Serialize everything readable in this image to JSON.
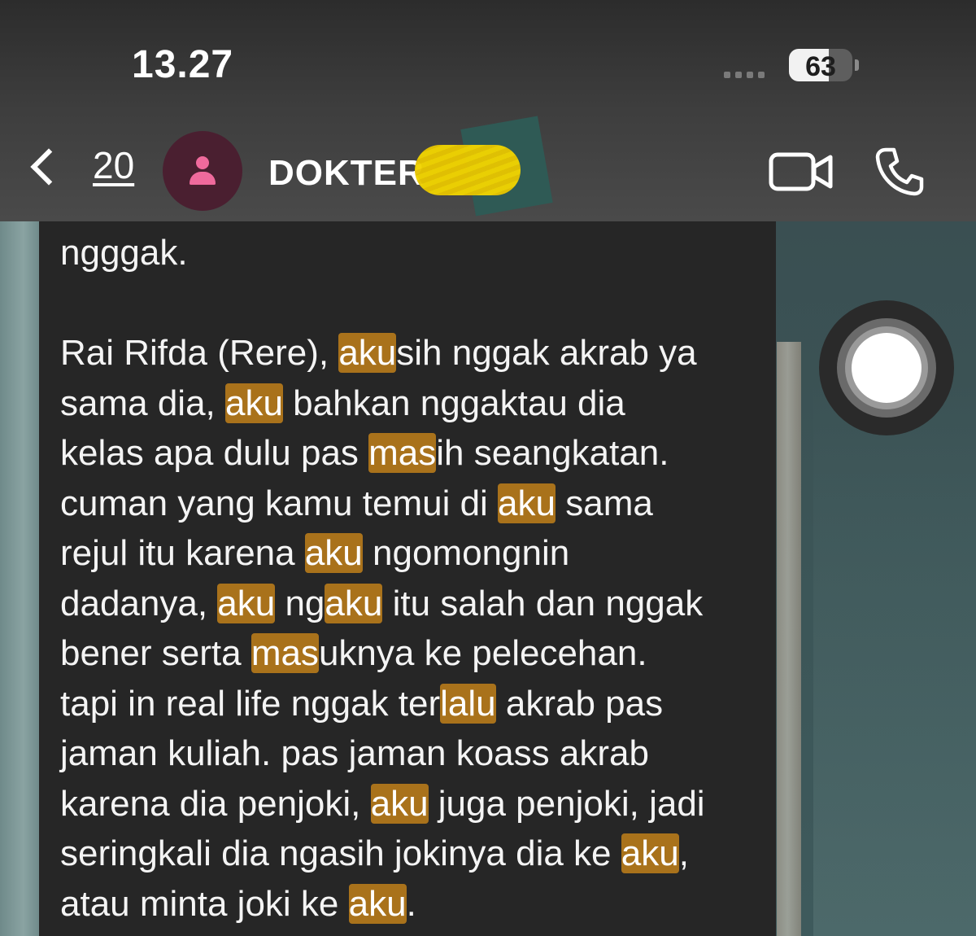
{
  "status_bar": {
    "time": "13.27",
    "battery": "63",
    "battery_level": 0.63
  },
  "header": {
    "back_count": "20",
    "contact_name": "DOKTER ",
    "icons": [
      "chevron-left-icon",
      "person-icon",
      "video-icon",
      "phone-icon"
    ]
  },
  "message": {
    "segments": [
      {
        "t": "ngggak.\n\nRai Rifda (Rere), "
      },
      {
        "t": "aku",
        "hl": true
      },
      {
        "t": "sih nggak akrab ya\nsama dia, "
      },
      {
        "t": "aku",
        "hl": true
      },
      {
        "t": " bahkan nggaktau dia\nkelas apa dulu pas "
      },
      {
        "t": "mas",
        "hl": true
      },
      {
        "t": "ih seangkatan.\ncuman yang kamu temui di "
      },
      {
        "t": "aku",
        "hl": true
      },
      {
        "t": " sama\nrejul itu karena "
      },
      {
        "t": "aku",
        "hl": true
      },
      {
        "t": " ngomongnin\ndadanya, "
      },
      {
        "t": "aku",
        "hl": true
      },
      {
        "t": " ng"
      },
      {
        "t": "aku",
        "hl": true
      },
      {
        "t": " itu salah dan nggak\nbener serta "
      },
      {
        "t": "mas",
        "hl": true
      },
      {
        "t": "uknya ke pelecehan.\ntapi in real life nggak ter"
      },
      {
        "t": "lalu",
        "hl": true
      },
      {
        "t": " akrab pas\njaman kuliah. pas jaman koass akrab\nkarena dia penjoki, "
      },
      {
        "t": "aku",
        "hl": true
      },
      {
        "t": " juga penjoki, jadi\nseringkali dia ngasih jokinya dia ke "
      },
      {
        "t": "aku",
        "hl": true
      },
      {
        "t": ",\natau minta joki ke "
      },
      {
        "t": "aku",
        "hl": true
      },
      {
        "t": "."
      }
    ]
  },
  "colors": {
    "highlight": "#a9721b",
    "bubble": "#262626",
    "avatar_bg": "#4a1f30",
    "avatar_icon": "#ef6a9c",
    "redaction": "#f1d400"
  }
}
